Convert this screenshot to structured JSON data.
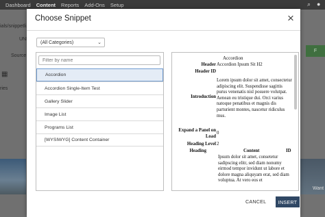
{
  "background": {
    "nav": [
      "Dashboard",
      "Content",
      "Reports",
      "Add-Ons",
      "Setup"
    ],
    "url_fragment": "ials/snippetli...",
    "unp": "UNP",
    "source_label": "Source",
    "tab_label": "ries",
    "side_text": "Want"
  },
  "modal": {
    "title": "Choose Snippet",
    "category_select": "(All Categories)",
    "filter_placeholder": "Filter by name",
    "items": [
      "Accordion",
      "Accordion Single-Item Test",
      "Gallery Slider",
      "Image List",
      "Programs List",
      "[WYSIWYG] Content Container"
    ],
    "selected_index": 0,
    "preview": {
      "title": "Accordion",
      "header_k": "Header",
      "header_v": "Accordion Ipsum Sit H2",
      "header_id_k": "Header ID",
      "intro_k": "Introduction",
      "intro_v": "Lorem ipsum dolor sit amet, consectetur adipiscing elit. Suspendisse sagittis purus venenatis nisl posuere volutpat. Aenean eu tristique dui. Orci varius natoque penatibus et magnis dis parturient montes, nascetur ridiculus mus.",
      "expand_k": "Expand a Panel on Load",
      "expand_v": "0",
      "heading_level_k": "Heading Level",
      "heading_level_v": "2",
      "heading_k": "Heading",
      "content_col": "Content",
      "id_col": "ID",
      "content_v": "Ipsum dolor sit amet, consetetur sadipscing elitr, sed diam nonumy eirmod tempor invidunt ut labore et dolore magna aliquyam erat, sed diam voluptua. At vero eos et"
    },
    "cancel_label": "CANCEL",
    "insert_label": "INSERT"
  },
  "colors": {
    "primary": "#2f4764",
    "selection": "#e4ecf6",
    "selection_border": "#6f9bd1"
  }
}
